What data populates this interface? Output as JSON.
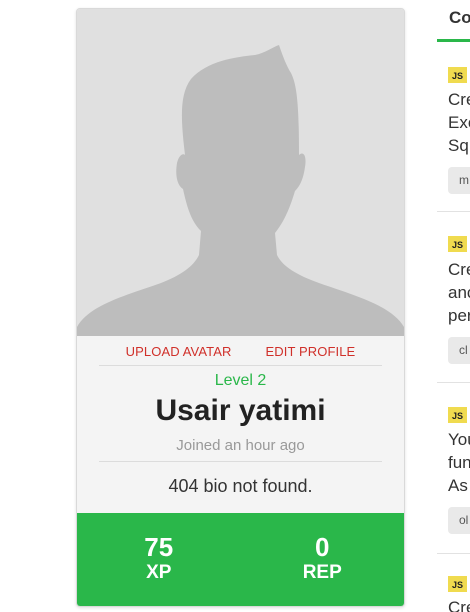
{
  "profile": {
    "upload_avatar": "UPLOAD AVATAR",
    "edit_profile": "EDIT PROFILE",
    "level": "Level 2",
    "name": "Usair yatimi",
    "joined": "Joined an hour ago",
    "bio": "404 bio not found.",
    "stats": [
      {
        "value": "75",
        "label": "XP"
      },
      {
        "value": "0",
        "label": "REP"
      }
    ]
  },
  "right_column": {
    "tab": "Co",
    "items": [
      {
        "badge": "JS",
        "lines": [
          "Cre",
          "Exe",
          "Sq"
        ],
        "tag": "m"
      },
      {
        "badge": "JS",
        "lines": [
          "Cre",
          "anc",
          "per"
        ],
        "tag": "cl"
      },
      {
        "badge": "JS",
        "lines": [
          "You",
          "fun",
          "As"
        ],
        "tag": "ol"
      },
      {
        "badge": "JS",
        "lines": [
          "Cre"
        ],
        "tag": ""
      }
    ]
  },
  "colors": {
    "accent_green": "#2ab74a",
    "link_red": "#d0302a",
    "js_yellow": "#f0db4f"
  },
  "icons": {
    "avatar": "default-person-silhouette-icon"
  }
}
